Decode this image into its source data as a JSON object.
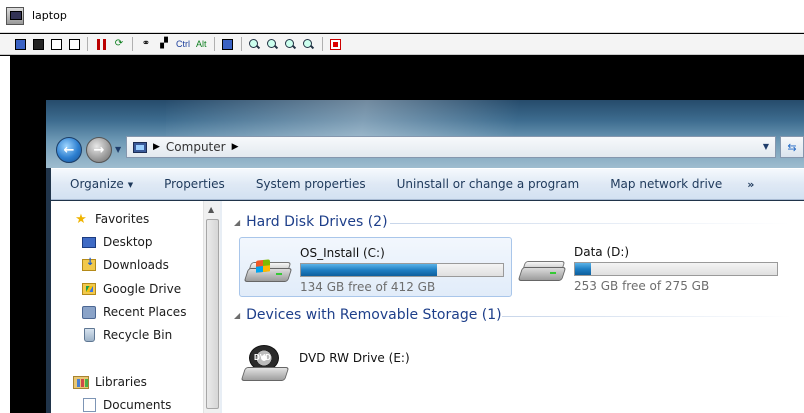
{
  "viewer": {
    "title": "laptop",
    "toolbar": {
      "ctrl_label": "Ctrl",
      "alt_label": "Alt"
    }
  },
  "explorer": {
    "address": {
      "location": "Computer"
    },
    "command_bar": {
      "organize": "Organize",
      "properties": "Properties",
      "system_properties": "System properties",
      "uninstall": "Uninstall or change a program",
      "map_drive": "Map network drive",
      "more": "»"
    },
    "nav": {
      "favorites": "Favorites",
      "items": [
        {
          "label": "Desktop",
          "icon": "desktop-icon"
        },
        {
          "label": "Downloads",
          "icon": "downloads-icon"
        },
        {
          "label": "Google Drive",
          "icon": "google-drive-icon"
        },
        {
          "label": "Recent Places",
          "icon": "recent-places-icon"
        },
        {
          "label": "Recycle Bin",
          "icon": "recycle-bin-icon"
        }
      ],
      "libraries": "Libraries",
      "library_items": [
        {
          "label": "Documents",
          "icon": "documents-icon"
        }
      ]
    },
    "groups": {
      "hard_disks": {
        "title": "Hard Disk Drives (2)",
        "drives": [
          {
            "name": "OS_Install (C:)",
            "free": "134 GB free of 412 GB",
            "used_fraction": 0.675,
            "selected": true
          },
          {
            "name": "Data (D:)",
            "free": "253 GB free of 275 GB",
            "used_fraction": 0.08,
            "selected": false
          }
        ]
      },
      "removable": {
        "title": "Devices with Removable Storage (1)",
        "devices": [
          {
            "name": "DVD RW Drive (E:)",
            "icon_label": "DVD"
          }
        ]
      }
    }
  },
  "colors": {
    "link_blue": "#1e3f8a",
    "command_text": "#1e395b",
    "bar_fill": "#1f7fc3"
  }
}
